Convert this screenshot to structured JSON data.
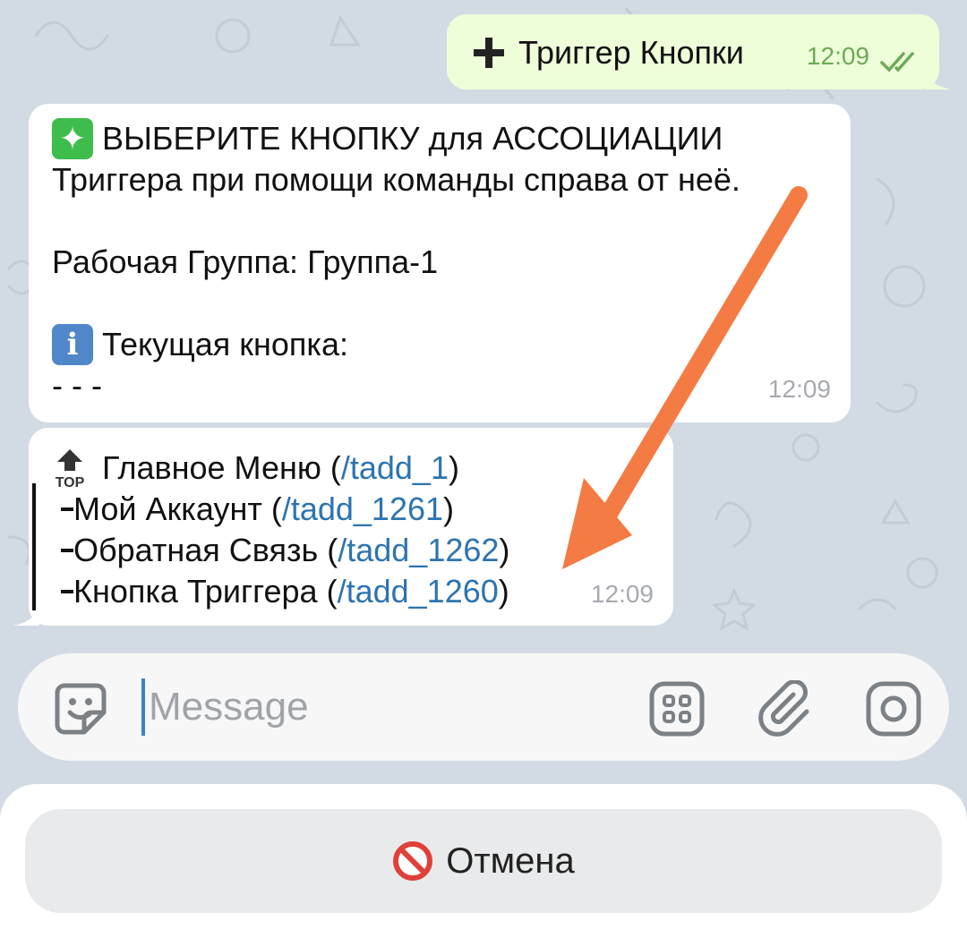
{
  "colors": {
    "wallpaper": "#d2dbe3",
    "outgoing_bubble": "#eefed8",
    "incoming_bubble": "#ffffff",
    "link": "#2d74b0",
    "arrow_annotation": "#f47b43",
    "cursor": "#3e83c4"
  },
  "messages": [
    {
      "direction": "outgoing",
      "icon": "plus-icon",
      "text": "Триггер Кнопки",
      "time": "12:09",
      "status": "read-double-check"
    },
    {
      "direction": "incoming",
      "lines": [
        {
          "icon": "sparkle-emoji",
          "text": "ВЫБЕРИТЕ КНОПКУ для АССОЦИАЦИИ"
        },
        {
          "text": "Триггера при помощи команды справа от неё."
        },
        {
          "text": ""
        },
        {
          "text": "Рабочая Группа: Группа-1"
        },
        {
          "text": ""
        },
        {
          "icon": "info-emoji",
          "text": "Текущая кнопка:"
        },
        {
          "text": "- - -"
        }
      ],
      "time": "12:09"
    },
    {
      "direction": "incoming",
      "tree": [
        {
          "icon": "top-arrow-emoji",
          "label": "Главное Меню",
          "open": " (",
          "command": "/tadd_1",
          "close": ")"
        },
        {
          "label": "Мой Аккаунт",
          "open": " (",
          "command": "/tadd_1261",
          "close": ")"
        },
        {
          "label": "Обратная Связь",
          "open": " (",
          "command": "/tadd_1262",
          "close": ")"
        },
        {
          "label": "Кнопка Триггера",
          "open": " (",
          "command": "/tadd_1260",
          "close": ")"
        }
      ],
      "time": "12:09"
    }
  ],
  "composer": {
    "placeholder": "Message",
    "icons": [
      "sticker-icon",
      "bot-menu-icon",
      "attach-icon",
      "camera-icon"
    ]
  },
  "reply_keyboard": {
    "cancel_icon": "no-entry-emoji",
    "cancel_label": "Отмена"
  },
  "annotation": {
    "type": "arrow",
    "color": "#f47b43",
    "points_to": "/tadd_1260"
  }
}
